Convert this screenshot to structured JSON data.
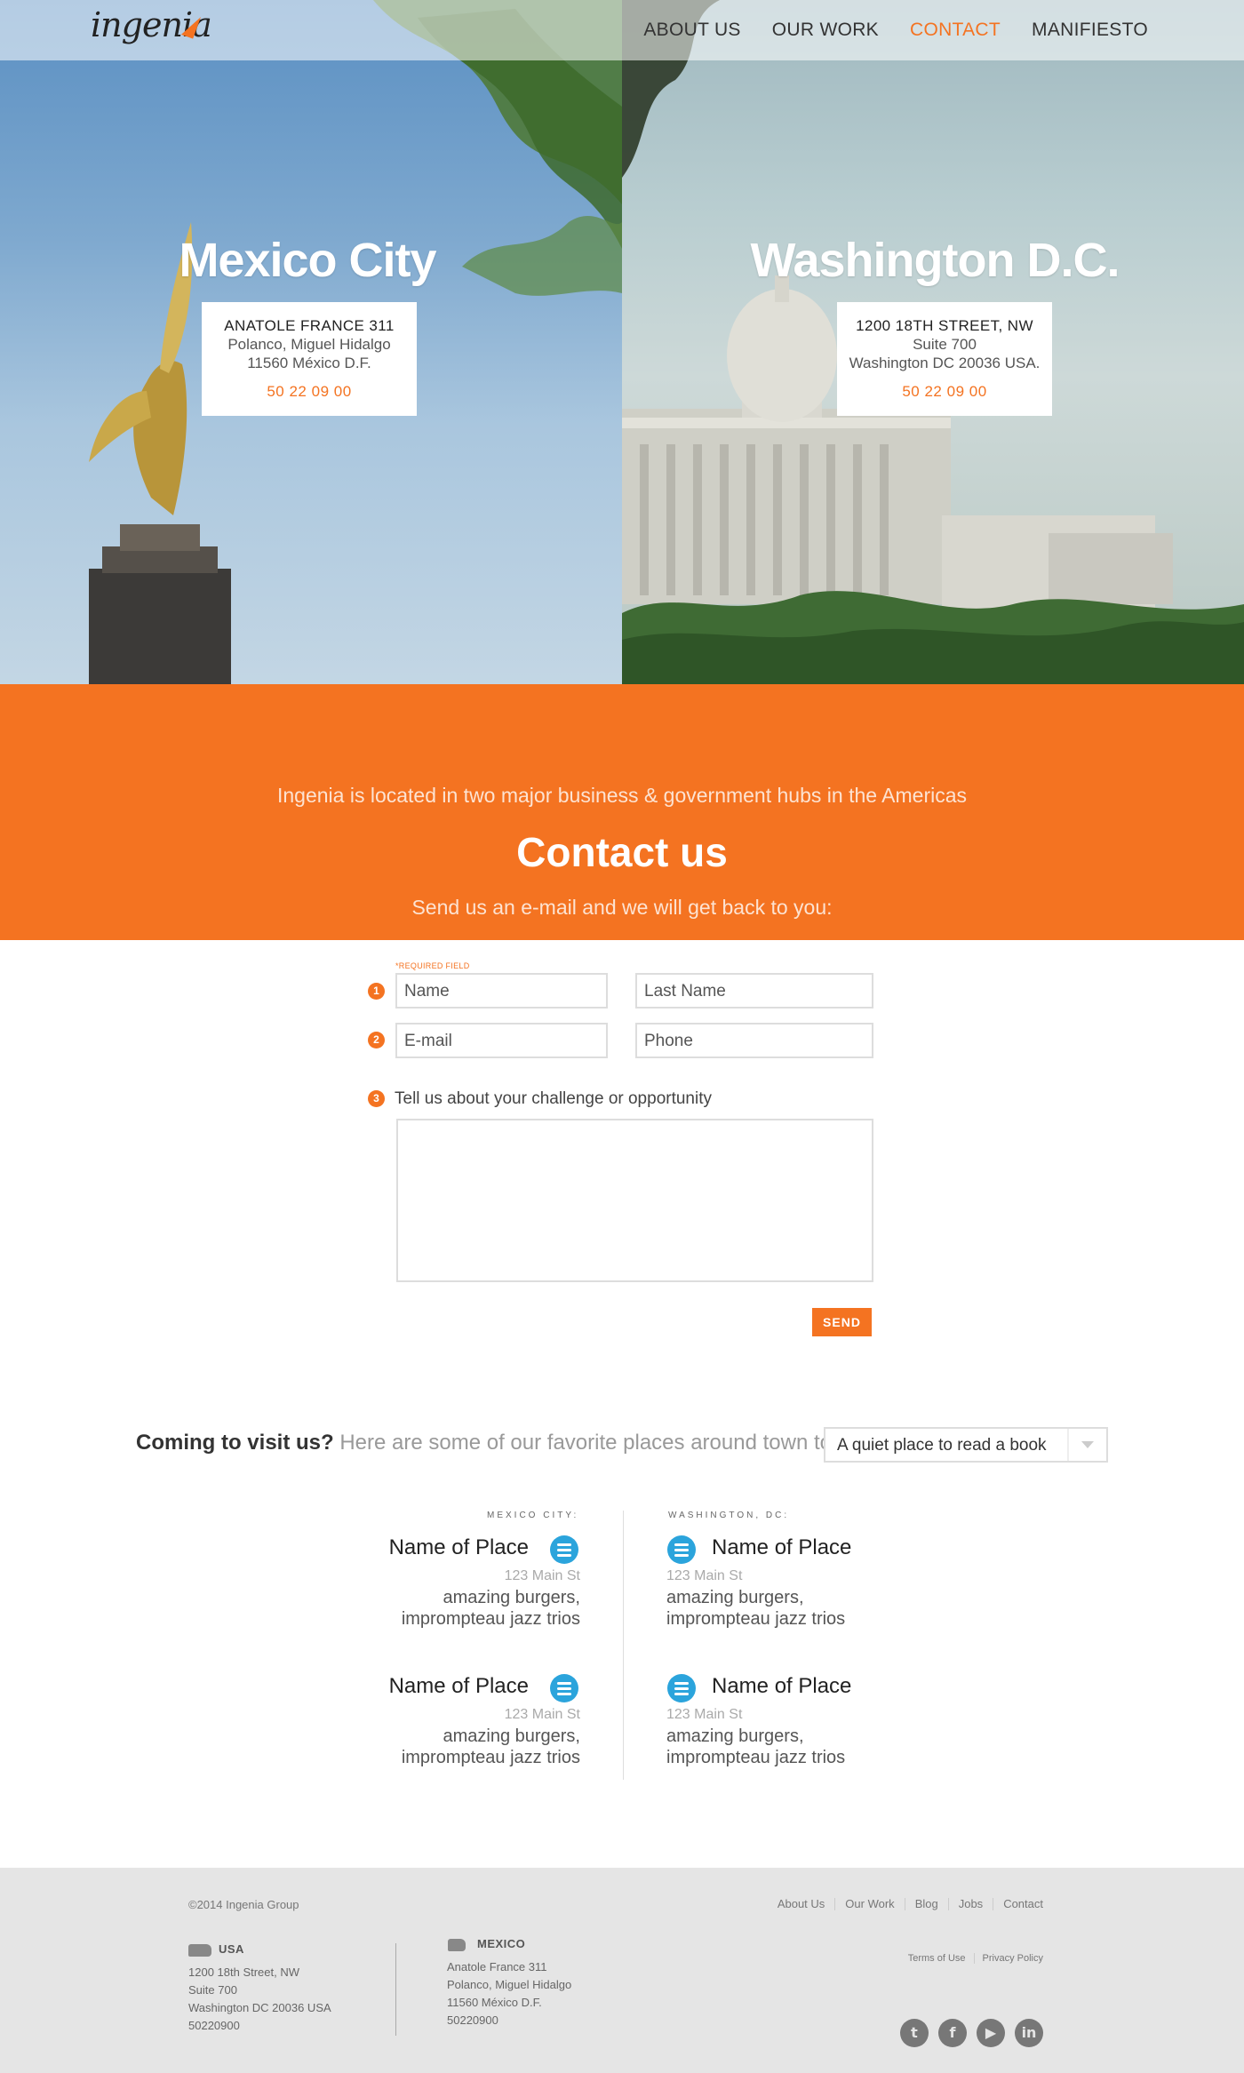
{
  "nav": {
    "logo": "ingenia",
    "links": [
      "ABOUT  US",
      "OUR WORK",
      "CONTACT",
      "MANIFIESTO"
    ],
    "active": "CONTACT"
  },
  "offices": [
    {
      "city": "Mexico City",
      "line1": "ANATOLE FRANCE 311",
      "line2": "Polanco, Miguel Hidalgo",
      "line3": "11560 México D.F.",
      "phone": "50 22 09 00"
    },
    {
      "city": "Washington D.C.",
      "line1": "1200 18TH STREET, NW",
      "line2": "Suite 700",
      "line3": "Washington DC 20036 USA.",
      "phone": "50 22 09 00"
    }
  ],
  "contact": {
    "intro": "Ingenia is located in two major business & government hubs in the Americas",
    "title": "Contact us",
    "subtitle": "Send us an e-mail and we will get back to you:",
    "required": "*REQUIRED FIELD",
    "steps": [
      "1",
      "2",
      "3"
    ],
    "placeholders": {
      "name": "Name",
      "last_name": "Last Name",
      "email": "E-mail",
      "phone": "Phone"
    },
    "textarea_label": "Tell us about your challenge or opportunity",
    "send": "SEND"
  },
  "visit": {
    "bold": "Coming to visit us?",
    "text": " Here are some of our favorite places around town to",
    "selected": "A quiet place to read a book",
    "mexico_header": "MEXICO CITY:",
    "washington_header": "WASHINGTON, DC:",
    "places": [
      {
        "name": "Name of Place",
        "address": "123 Main St",
        "desc": "amazing burgers, imprompteau jazz trios",
        "icon": "burger-icon"
      },
      {
        "name": "Name of Place",
        "address": "123 Main St",
        "desc": "amazing burgers, imprompteau jazz trios",
        "icon": "burger-icon"
      },
      {
        "name": "Name of Place",
        "address": "123 Main St",
        "desc": "amazing burgers, imprompteau jazz trios",
        "icon": "burger-icon"
      },
      {
        "name": "Name of Place",
        "address": "123 Main St",
        "desc": "amazing burgers, imprompteau jazz trios",
        "icon": "burger-icon"
      }
    ]
  },
  "footer": {
    "copyright": "©2014 Ingenia Group",
    "links": [
      "About Us",
      "Our Work",
      "Blog",
      "Jobs",
      "Contact"
    ],
    "legal": [
      "Terms of Use",
      "Privacy Policy"
    ],
    "usa": {
      "label": "USA",
      "lines": [
        "1200 18th Street, NW",
        "Suite 700",
        "Washington DC 20036 USA",
        "50220900"
      ]
    },
    "mexico": {
      "label": "MEXICO",
      "lines": [
        "Anatole France 311",
        "Polanco, Miguel Hidalgo",
        "11560 México D.F.",
        "50220900"
      ]
    },
    "social": [
      "twitter-icon",
      "facebook-icon",
      "youtube-icon",
      "linkedin-icon"
    ]
  },
  "colors": {
    "accent": "#f47321",
    "burger": "#2ba4dc",
    "footer_bg": "#e5e5e5"
  }
}
